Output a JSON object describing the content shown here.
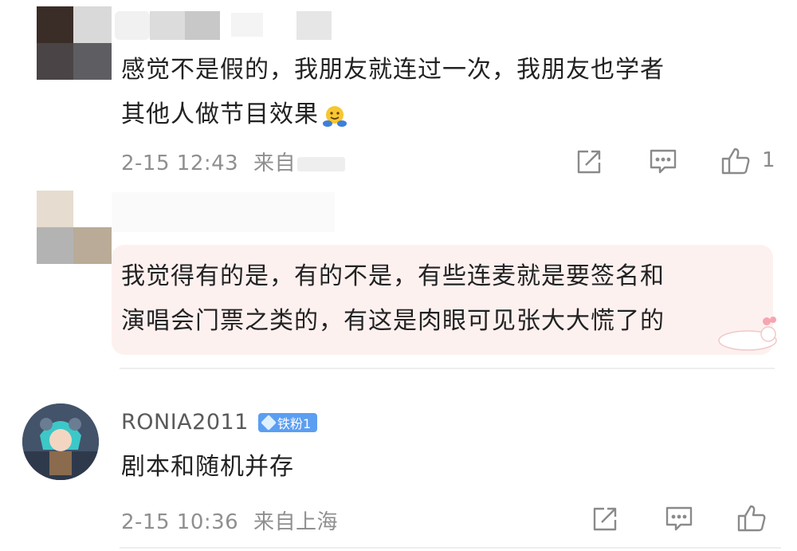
{
  "comments": [
    {
      "text_line1": "感觉不是假的，我朋友就连过一次，我朋友也学者",
      "text_line2": "其他人做节目效果",
      "time": "2-15 12:43",
      "source_prefix": "来自",
      "like_count": "1",
      "emoji": "hugging-face"
    },
    {
      "text_line1": "我觉得有的是，有的不是，有些连麦就是要签名和",
      "text_line2": "演唱会门票之类的，有这是肉眼可见张大大慌了的"
    },
    {
      "username": "RONIA2011",
      "badge": "铁粉1",
      "text": "剧本和随机并存",
      "time": "2-15 10:36",
      "source": "来自上海"
    }
  ],
  "icons": {
    "share": "share-icon",
    "comment": "comment-icon",
    "like": "thumbs-up-icon"
  },
  "colors": {
    "badge": "#5b9ef2",
    "meta_text": "#8f8f8f",
    "divider": "#eeeeee"
  }
}
